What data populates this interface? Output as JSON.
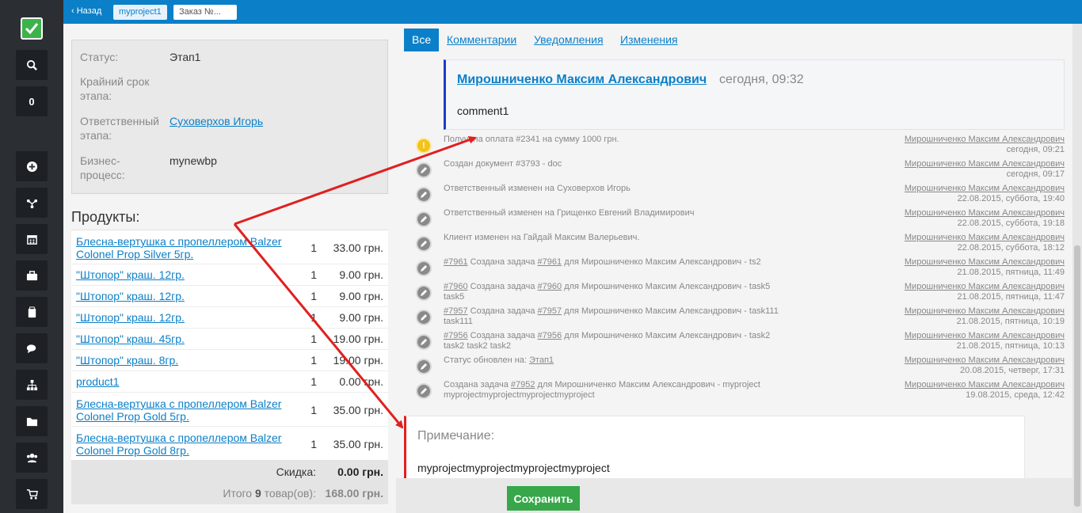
{
  "colors": {
    "accent": "#0b7fc8",
    "sidebar": "#2b2e33",
    "success": "#37a74a",
    "annotation": "#e02020"
  },
  "sidebar": {
    "logo_icon": "checkbox-icon",
    "counter": "0",
    "items": [
      {
        "icon": "search-icon"
      },
      {
        "icon": "plus-circle-icon"
      },
      {
        "icon": "branch-icon"
      },
      {
        "icon": "calendar-icon"
      },
      {
        "icon": "briefcase-icon"
      },
      {
        "icon": "clipboard-icon"
      },
      {
        "icon": "chat-icon"
      },
      {
        "icon": "sitemap-icon"
      },
      {
        "icon": "folder-icon"
      },
      {
        "icon": "users-icon"
      },
      {
        "icon": "cart-icon"
      }
    ]
  },
  "breadcrumb": {
    "back": "‹ Назад",
    "project": "myproject1",
    "order": "Заказ №..."
  },
  "info": {
    "status_label": "Статус:",
    "status_value": "Этап1",
    "deadline_label": "Крайний срок этапа:",
    "responsible_label": "Ответственный этапа:",
    "responsible_value": "Суховерхов Игорь",
    "process_label": "Бизнес-процесс:",
    "process_value": "mynewbp"
  },
  "products": {
    "title": "Продукты:",
    "rows": [
      {
        "name": "Блесна-вертушка с пропеллером Balzer Colonel Prop Silver 5гр.",
        "qty": "1",
        "price": "33.00 грн."
      },
      {
        "name": "\"Штопор\" краш. 12гр.",
        "qty": "1",
        "price": "9.00 грн."
      },
      {
        "name": "\"Штопор\" краш. 12гр.",
        "qty": "1",
        "price": "9.00 грн."
      },
      {
        "name": "\"Штопор\" краш. 12гр.",
        "qty": "1",
        "price": "9.00 грн."
      },
      {
        "name": "\"Штопор\" краш. 45гр.",
        "qty": "1",
        "price": "19.00 грн."
      },
      {
        "name": "\"Штопор\" краш. 8гр.",
        "qty": "1",
        "price": "19.00 грн."
      },
      {
        "name": "product1",
        "qty": "1",
        "price": "0.00 грн."
      },
      {
        "name": "Блесна-вертушка с пропеллером Balzer Colonel Prop Gold 5гр.",
        "qty": "1",
        "price": "35.00 грн."
      },
      {
        "name": "Блесна-вертушка с пропеллером Balzer Colonel Prop Gold 8гр.",
        "qty": "1",
        "price": "35.00 грн."
      }
    ],
    "discount_label": "Скидка:",
    "discount_value": "0.00 грн.",
    "total_prefix": "Итого",
    "total_count": "9",
    "total_suffix": "товар(ов):",
    "total_value": "168.00 грн."
  },
  "tabs": [
    {
      "label": "Все"
    },
    {
      "label": "Комментарии"
    },
    {
      "label": "Уведомления"
    },
    {
      "label": "Изменения"
    }
  ],
  "comment": {
    "author": "Мирошниченко Максим Александрович",
    "time": "сегодня, 09:32",
    "text": "comment1"
  },
  "events": [
    {
      "icon": "warning-icon",
      "text": "Получена оплата #2341 на сумму 1000 грн.",
      "who": "Мирошниченко Максим Александрович",
      "when": "сегодня, 09:21"
    },
    {
      "icon": "pencil-icon",
      "text": "Создан документ #3793 - doc",
      "who": "Мирошниченко Максим Александрович",
      "when": "сегодня, 09:17"
    },
    {
      "icon": "pencil-icon",
      "text": "Ответственный изменен на Суховерхов Игорь",
      "who": "Мирошниченко Максим Александрович",
      "when": "22.08.2015, суббота, 19:40"
    },
    {
      "icon": "pencil-icon",
      "text": "Ответственный изменен на Грищенко Евгений Владимирович",
      "who": "Мирошниченко Максим Александрович",
      "when": "22.08.2015, суббота, 19:18"
    },
    {
      "icon": "pencil-icon",
      "text": "Клиент изменен на Гайдай Максим Валерьевич.",
      "who": "Мирошниченко Максим Александрович",
      "when": "22.08.2015, суббота, 18:12"
    },
    {
      "icon": "pencil-icon",
      "link1": "#7961",
      "mid": " Создана задача ",
      "link2": "#7961",
      "rest": " для Мирошниченко Максим Александрович - ts2",
      "who": "Мирошниченко Максим Александрович",
      "when": "21.08.2015, пятница, 11:49"
    },
    {
      "icon": "pencil-icon",
      "link1": "#7960",
      "mid": " Создана задача ",
      "link2": "#7960",
      "rest": " для Мирошниченко Максим Александрович - task5 task5",
      "who": "Мирошниченко Максим Александрович",
      "when": "21.08.2015, пятница, 11:47"
    },
    {
      "icon": "pencil-icon",
      "link1": "#7957",
      "mid": " Создана задача ",
      "link2": "#7957",
      "rest": " для Мирошниченко Максим Александрович - task111 task111",
      "who": "Мирошниченко Максим Александрович",
      "when": "21.08.2015, пятница, 10:19"
    },
    {
      "icon": "pencil-icon",
      "link1": "#7956",
      "mid": " Создана задача ",
      "link2": "#7956",
      "rest": " для Мирошниченко Максим Александрович - task2 task2 task2 task2",
      "who": "Мирошниченко Максим Александрович",
      "when": "21.08.2015, пятница, 10:13"
    },
    {
      "icon": "pencil-icon",
      "text_prefix": "Статус обновлен на: ",
      "link2": "Этап1",
      "who": "Мирошниченко Максим Александрович",
      "when": "20.08.2015, четверг, 17:31"
    },
    {
      "icon": "pencil-icon",
      "mid": "Создана задача ",
      "link2": "#7952",
      "rest": " для Мирошниченко Максим Александрович - myproject myprojectmyprojectmyprojectmyproject",
      "who": "Мирошниченко Максим Александрович",
      "when": "19.08.2015, среда, 12:42"
    }
  ],
  "note": {
    "label": "Примечание:",
    "text": "myprojectmyprojectmyprojectmyproject"
  },
  "save_label": "Сохранить"
}
